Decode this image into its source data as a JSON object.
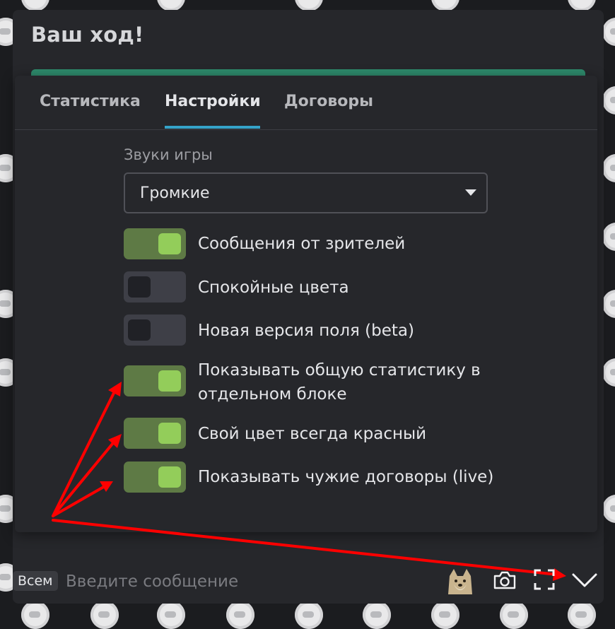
{
  "turn_title": "Ваш ход!",
  "tabs": [
    {
      "label": "Статистика",
      "active": false
    },
    {
      "label": "Настройки",
      "active": true
    },
    {
      "label": "Договоры",
      "active": false
    }
  ],
  "settings": {
    "sound_label": "Звуки игры",
    "sound_value": "Громкие",
    "options": [
      {
        "label": "Сообщения от зрителей",
        "on": true
      },
      {
        "label": "Спокойные цвета",
        "on": false
      },
      {
        "label": "Новая версия поля (beta)",
        "on": false
      },
      {
        "label": "Показывать общую статистику в отдельном блоке",
        "on": true
      },
      {
        "label": "Свой цвет всегда красный",
        "on": true
      },
      {
        "label": "Показывать чужие договоры (live)",
        "on": true
      }
    ]
  },
  "chat": {
    "scope": "Всем",
    "placeholder": "Введите сообщение"
  },
  "icons": [
    "doge-icon",
    "camera-icon",
    "fullscreen-icon",
    "chevron-down-icon"
  ],
  "colors": {
    "accent_tab": "#35a3c9",
    "toggle_on": "#5e7a45",
    "toggle_knob_on": "#93cd5a",
    "annotation_arrow": "#ff0000",
    "strip": "#2e8a6c"
  }
}
